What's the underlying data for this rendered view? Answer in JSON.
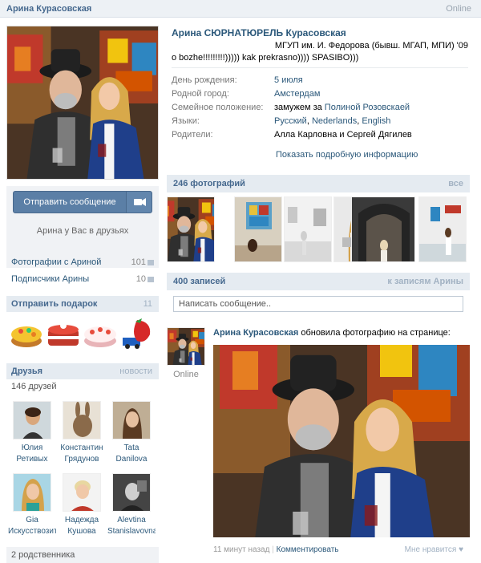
{
  "header": {
    "name": "Арина Курасовская",
    "online": "Online"
  },
  "profile": {
    "name": "Арина СЮРНАТЮРЕЛЬ Курасовская",
    "status_line1": "МГУП им. И. Федорова (бывш. МГАП, МПИ) '09",
    "status_line2": "o bozhe!!!!!!!!!))))) kak prekrasno)))) SPASIBO)))",
    "info": [
      {
        "key": "День рождения:",
        "value": "5 июля"
      },
      {
        "key": "Родной город:",
        "value": "Амстердам"
      },
      {
        "key": "Семейное положение:",
        "prefix": "замужем за ",
        "value": "Полиной Розовскаей"
      },
      {
        "key": "Языки:",
        "langs": [
          "Русский",
          "Nederlands",
          "English"
        ]
      },
      {
        "key": "Родители:",
        "value": "Алла Карловна и Сергей Дягилев"
      }
    ],
    "show_more": "Показать подробную информацию"
  },
  "actions": {
    "send_message": "Отправить сообщение",
    "friends_note": "Арина у Вас в друзьях"
  },
  "left_links": [
    {
      "label": "Фотографии с Ариной",
      "count": "101"
    },
    {
      "label": "Подписчики Арины",
      "count": "10"
    }
  ],
  "gifts": {
    "title": "Отправить подарок",
    "count": "11"
  },
  "friends": {
    "title": "Друзья",
    "more": "новости",
    "count_label": "146 друзей",
    "items": [
      {
        "line1": "Юлия",
        "line2": "Ретивых"
      },
      {
        "line1": "Константин",
        "line2": "Грядунов"
      },
      {
        "line1": "Tata",
        "line2": "Danilova"
      },
      {
        "line1": "Gia",
        "line2": "Искусствозить"
      },
      {
        "line1": "Надежда",
        "line2": "Кушова"
      },
      {
        "line1": "Alevtina",
        "line2": "Stanislavovna"
      }
    ],
    "relatives": "2 родственника"
  },
  "photos": {
    "title": "246 фотографий",
    "all": "все"
  },
  "wall": {
    "title": "400 записей",
    "to_posts": "к записям Арины",
    "compose_placeholder": "Написать сообщение.."
  },
  "post": {
    "author": "Арина Курасовская",
    "action": " обновила фотографию на странице:",
    "online": "Online",
    "time": "11 минут назад",
    "comment": "Комментировать",
    "like": "Мне нравится"
  },
  "colors": {
    "link": "#2B587A",
    "header_bg": "#E5EBF1",
    "button": "#5B7FA6"
  }
}
